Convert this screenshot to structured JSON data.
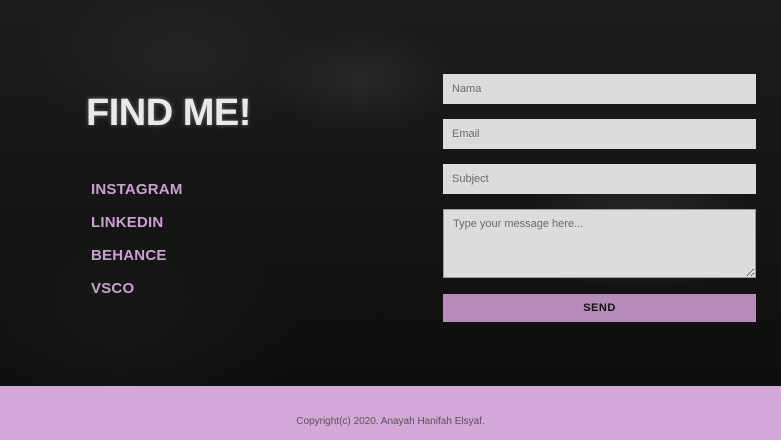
{
  "heading": "FIND ME!",
  "social_links": [
    {
      "label": "INSTAGRAM"
    },
    {
      "label": "LINKEDIN"
    },
    {
      "label": "BEHANCE"
    },
    {
      "label": "VSCO"
    }
  ],
  "form": {
    "name_placeholder": "Nama",
    "email_placeholder": "Email",
    "subject_placeholder": "Subject",
    "message_placeholder": "Type your message here...",
    "send_label": "SEND"
  },
  "footer": {
    "copyright": "Copyright(c) 2020. Anayah Hanifah Elsyaf."
  },
  "colors": {
    "accent": "#c9a0d0",
    "button": "#b58bb8",
    "footer": "#d4a7d8"
  }
}
